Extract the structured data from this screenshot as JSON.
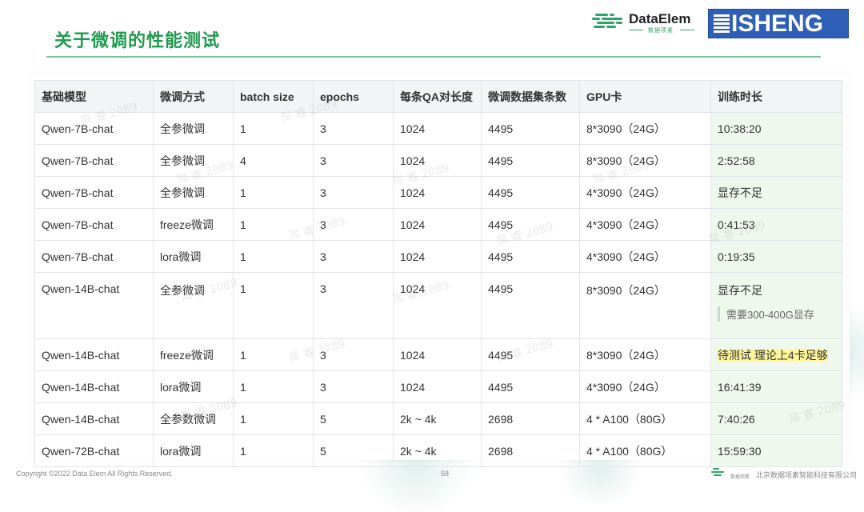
{
  "slide": {
    "title": "关于微调的性能测试",
    "page_number": "58"
  },
  "logos": {
    "dataelem_name": "DataElem",
    "dataelem_sub": "数据项素",
    "isheng": "ISHENG"
  },
  "table": {
    "headers": [
      "基础模型",
      "微调方式",
      "batch size",
      "epochs",
      "每条QA对长度",
      "微调数据集条数",
      "GPU卡",
      "训练时长"
    ],
    "rows": [
      {
        "model": "Qwen-7B-chat",
        "method": "全参微调",
        "batch": "1",
        "epochs": "3",
        "qa_len": "1024",
        "count": "4495",
        "gpu": "8*3090（24G）",
        "time": "10:38:20"
      },
      {
        "model": "Qwen-7B-chat",
        "method": "全参微调",
        "batch": "4",
        "epochs": "3",
        "qa_len": "1024",
        "count": "4495",
        "gpu": "8*3090（24G）",
        "time": "2:52:58"
      },
      {
        "model": "Qwen-7B-chat",
        "method": "全参微调",
        "batch": "1",
        "epochs": "3",
        "qa_len": "1024",
        "count": "4495",
        "gpu": "4*3090（24G）",
        "time": "显存不足"
      },
      {
        "model": "Qwen-7B-chat",
        "method": "freeze微调",
        "batch": "1",
        "epochs": "3",
        "qa_len": "1024",
        "count": "4495",
        "gpu": "4*3090（24G）",
        "time": "0:41:53"
      },
      {
        "model": "Qwen-7B-chat",
        "method": "lora微调",
        "batch": "1",
        "epochs": "3",
        "qa_len": "1024",
        "count": "4495",
        "gpu": "4*3090（24G）",
        "time": "0:19:35"
      },
      {
        "model": "Qwen-14B-chat",
        "method": "全参微调",
        "batch": "1",
        "epochs": "3",
        "qa_len": "1024",
        "count": "4495",
        "gpu": "8*3090（24G）",
        "time": "显存不足",
        "note": "需要300-400G显存"
      },
      {
        "model": "Qwen-14B-chat",
        "method": "freeze微调",
        "batch": "1",
        "epochs": "3",
        "qa_len": "1024",
        "count": "4495",
        "gpu": "8*3090（24G）",
        "time": "待测试 理论上4卡足够",
        "highlight": true
      },
      {
        "model": "Qwen-14B-chat",
        "method": "lora微调",
        "batch": "1",
        "epochs": "3",
        "qa_len": "1024",
        "count": "4495",
        "gpu": "4*3090（24G）",
        "time": "16:41:39"
      },
      {
        "model": "Qwen-14B-chat",
        "method": "全参数微调",
        "batch": "1",
        "epochs": "5",
        "qa_len": "2k ~ 4k",
        "count": "2698",
        "gpu": "4 * A100（80G）",
        "time": "7:40:26"
      },
      {
        "model": "Qwen-72B-chat",
        "method": "lora微调",
        "batch": "1",
        "epochs": "5",
        "qa_len": "2k ~ 4k",
        "count": "2698",
        "gpu": "4 * A100（80G）",
        "time": "15:59:30"
      }
    ]
  },
  "watermark": "简 睿 2089",
  "footer": {
    "copyright": "Copyright ©2022 Data Elem All Rights Reserved.",
    "company": "北京数据项素智能科技有限公司",
    "logo_caption": "数据项素"
  },
  "colors": {
    "title_green": "#1f9a4e",
    "header_bg": "#f3f4f6",
    "last_col_bg": "#eef8ec",
    "highlight_yellow": "#fff59a",
    "isheng_blue": "#2f5fb7"
  }
}
